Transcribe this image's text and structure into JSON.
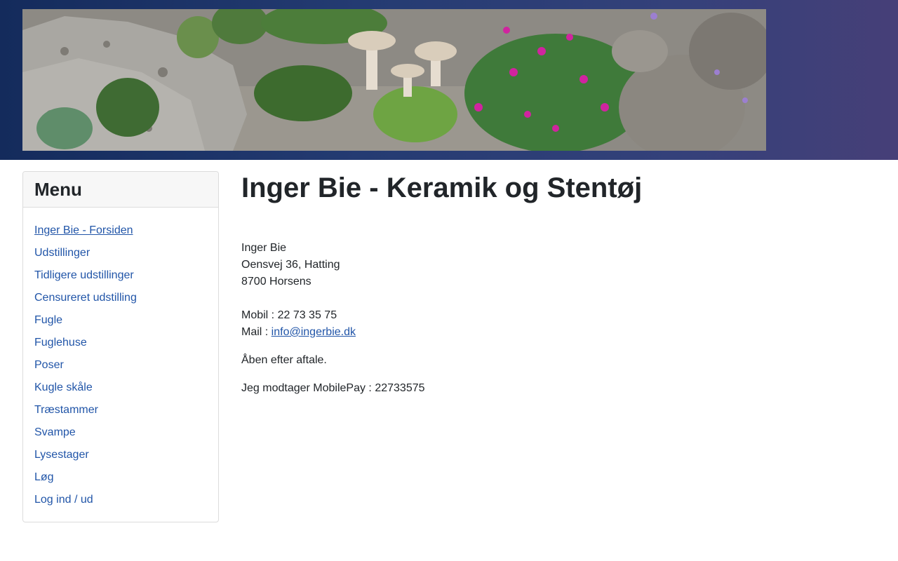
{
  "menu": {
    "title": "Menu",
    "items": [
      {
        "label": "Inger Bie - Forsiden"
      },
      {
        "label": "Udstillinger"
      },
      {
        "label": "Tidligere udstillinger"
      },
      {
        "label": "Censureret udstilling"
      },
      {
        "label": "Fugle"
      },
      {
        "label": "Fuglehuse"
      },
      {
        "label": "Poser"
      },
      {
        "label": "Kugle skåle"
      },
      {
        "label": "Træstammer"
      },
      {
        "label": "Svampe"
      },
      {
        "label": "Lysestager"
      },
      {
        "label": "Løg"
      },
      {
        "label": "Log ind / ud"
      }
    ]
  },
  "main": {
    "title": "Inger Bie - Keramik og Stentøj",
    "name": "Inger Bie",
    "street": "Oensvej 36, Hatting",
    "city": "8700 Horsens",
    "mobile": "Mobil : 22 73 35 75",
    "mail_prefix": "Mail : ",
    "mail": "info@ingerbie.dk",
    "hours": "Åben efter aftale.",
    "mobilepay": "Jeg modtager MobilePay : 22733575"
  },
  "colors": {
    "header_gradient_start": "#142b5c",
    "header_gradient_end": "#463f78",
    "link": "#2155a8",
    "text": "#212529"
  }
}
